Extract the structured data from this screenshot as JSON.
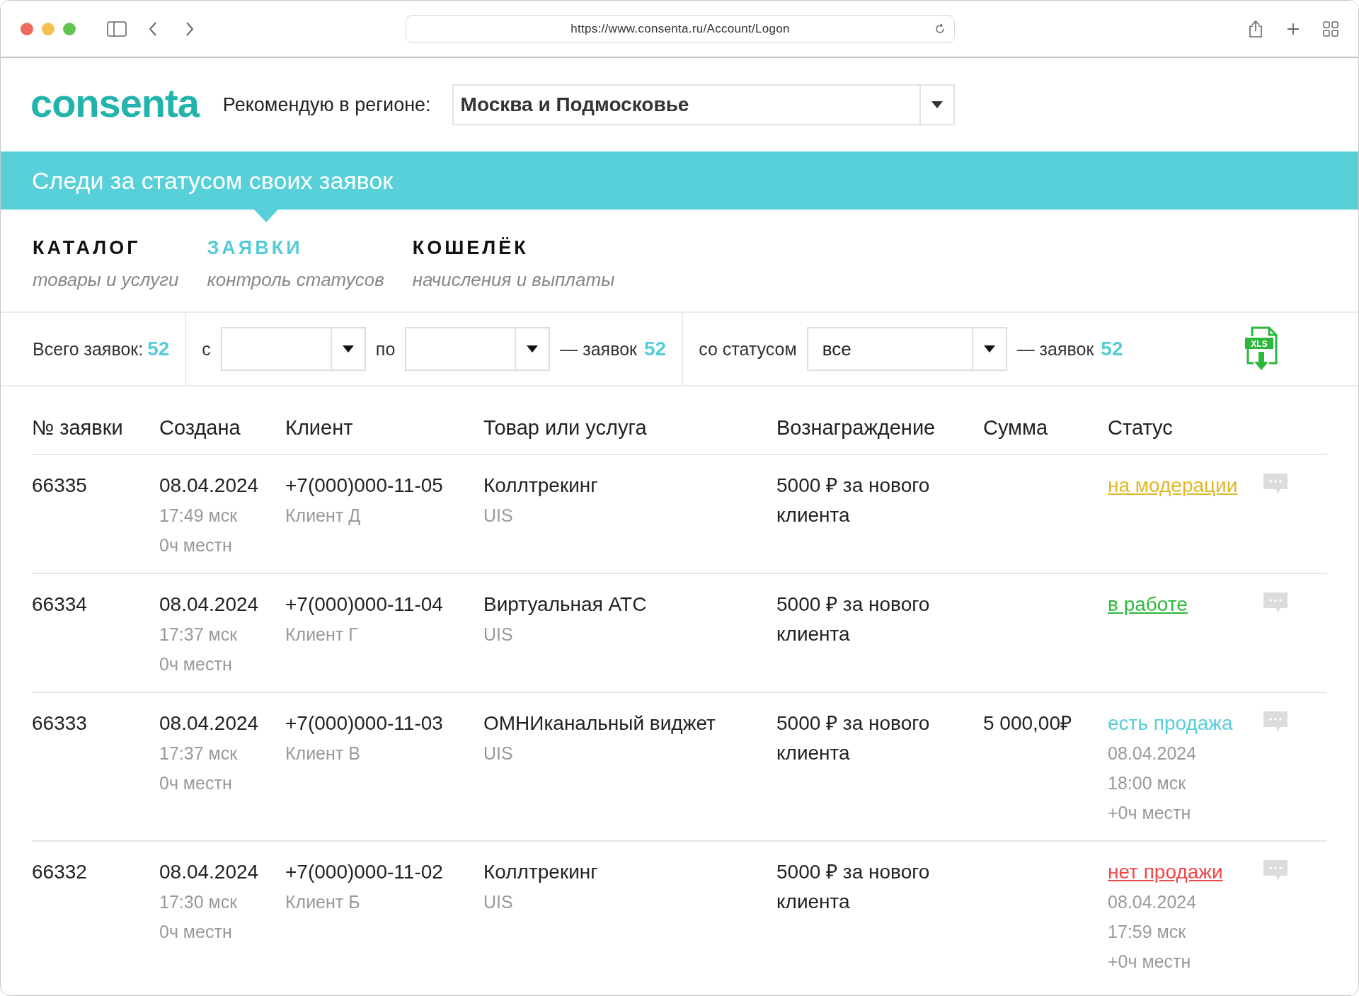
{
  "browser": {
    "url": "https://www.consenta.ru/Account/Logon"
  },
  "header": {
    "logo": "consenta",
    "region_label": "Рекомендую в регионе:",
    "region_value": "Москва и Подмосковье"
  },
  "banner": {
    "text": "Следи за статусом своих заявок"
  },
  "tabs": [
    {
      "title": "КАТАЛОГ",
      "subtitle": "товары и услуги",
      "selected": false
    },
    {
      "title": "ЗАЯВКИ",
      "subtitle": "контроль статусов",
      "selected": true
    },
    {
      "title": "КОШЕЛЁК",
      "subtitle": "начисления и выплаты",
      "selected": false
    }
  ],
  "filters": {
    "total_label": "Всего заявок:",
    "total_count": "52",
    "from_label": "с",
    "to_label": "по",
    "range_label": "— заявок",
    "range_count": "52",
    "status_label": "со статусом",
    "status_value": "все",
    "status_count_label": "— заявок",
    "status_count": "52",
    "export_label": "XLS"
  },
  "table": {
    "columns": [
      "№ заявки",
      "Создана",
      "Клиент",
      "Товар или услуга",
      "Вознаграждение",
      "Сумма",
      "Статус"
    ],
    "rows": [
      {
        "id": "66335",
        "date": "08.04.2024",
        "time": "17:49 мск",
        "local": "0ч местн",
        "phone": "+7(000)000-11-05",
        "client": "Клиент Д",
        "product": "Коллтрекинг",
        "vendor": "UIS",
        "reward": "5000 ₽ за нового клиента",
        "status": {
          "text": "на модерации",
          "color": "#e0b825",
          "underlined": true
        }
      },
      {
        "id": "66334",
        "date": "08.04.2024",
        "time": "17:37 мск",
        "local": "0ч местн",
        "phone": "+7(000)000-11-04",
        "client": "Клиент Г",
        "product": "Виртуальная АТС",
        "vendor": "UIS",
        "reward": "5000 ₽ за нового клиента",
        "status": {
          "text": "в работе",
          "color": "#2cb83c",
          "underlined": true
        }
      },
      {
        "id": "66333",
        "date": "08.04.2024",
        "time": "17:37 мск",
        "local": "0ч местн",
        "phone": "+7(000)000-11-03",
        "client": "Клиент В",
        "product": "ОМНИканальный виджет",
        "vendor": "UIS",
        "reward": "5000 ₽ за нового клиента",
        "sum": "5 000,00₽",
        "status": {
          "text": "есть продажа",
          "color": "#57ccd8",
          "underlined": false,
          "date": "08.04.2024",
          "time": "18:00 мск",
          "local": "+0ч местн"
        }
      },
      {
        "id": "66332",
        "date": "08.04.2024",
        "time": "17:30 мск",
        "local": "0ч местн",
        "phone": "+7(000)000-11-02",
        "client": "Клиент Б",
        "product": "Коллтрекинг",
        "vendor": "UIS",
        "reward": "5000 ₽ за нового клиента",
        "status": {
          "text": "нет продажи",
          "color": "#f04848",
          "underlined": true,
          "date": "08.04.2024",
          "time": "17:59 мск",
          "local": "+0ч местн"
        }
      }
    ]
  }
}
